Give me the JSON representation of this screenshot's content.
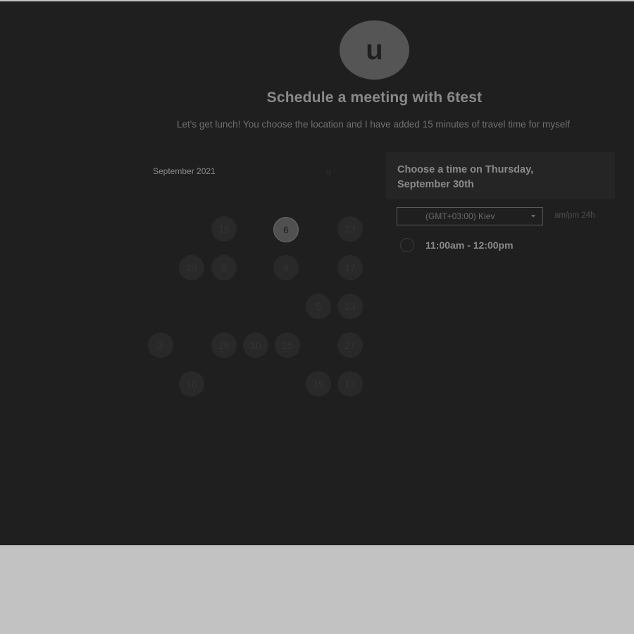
{
  "header": {
    "avatar_initial": "u",
    "title": "Schedule a meeting with 6test",
    "description": "Let's get lunch! You choose the location and I have added 15 minutes of travel time for myself"
  },
  "calendar": {
    "month_label": "September 2021",
    "next_icon": "chevron-right-icon",
    "weekdays": [
      "",
      "",
      "",
      "",
      "",
      "",
      ""
    ],
    "days": [
      {
        "label": "18",
        "selected": false
      },
      {
        "label": "6",
        "selected": true
      },
      {
        "label": "23",
        "selected": false
      },
      {
        "label": "29",
        "selected": false
      },
      {
        "label": "8",
        "selected": false
      },
      {
        "label": "9",
        "selected": false
      },
      {
        "label": "17",
        "selected": false
      },
      {
        "label": "5",
        "selected": false
      },
      {
        "label": "23",
        "selected": false
      },
      {
        "label": "3",
        "selected": false
      },
      {
        "label": "26",
        "selected": false
      },
      {
        "label": "10",
        "selected": false
      },
      {
        "label": "25",
        "selected": false
      },
      {
        "label": "27",
        "selected": false
      },
      {
        "label": "10",
        "selected": false
      },
      {
        "label": "19",
        "selected": false
      },
      {
        "label": "13",
        "selected": false
      }
    ]
  },
  "time_panel": {
    "heading": "Choose a time on Thursday, September 30th",
    "timezone": "(GMT+03:00) Kiev",
    "format_ampm": "am/pm",
    "format_24h": "24h",
    "slots": [
      {
        "label": "11:00am - 12:00pm"
      }
    ]
  },
  "colors": {
    "panel_bg": "#1f1f1f",
    "page_bg": "#c2c2c2",
    "text": "#8a8a8a"
  }
}
